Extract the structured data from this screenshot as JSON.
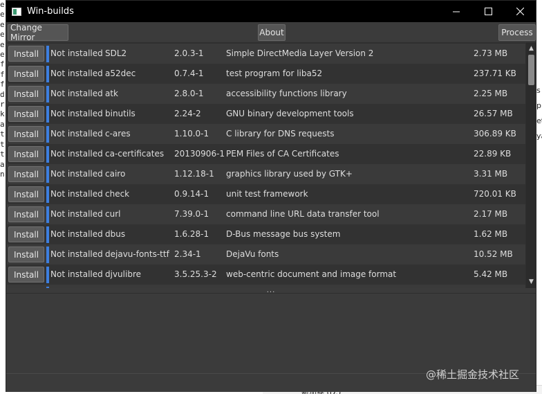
{
  "window": {
    "title": "Win-builds",
    "controls": [
      "minimize-icon",
      "maximize-icon",
      "close-icon"
    ]
  },
  "toolbar": {
    "change_mirror_label": "Change Mirror",
    "about_label": "About",
    "process_label": "Process"
  },
  "packages": [
    {
      "action": "Install",
      "status": "Not installed",
      "name": "SDL2",
      "version": "2.0.3-1",
      "description": "Simple DirectMedia Layer Version 2",
      "size": "2.73 MB"
    },
    {
      "action": "Install",
      "status": "Not installed",
      "name": "a52dec",
      "version": "0.7.4-1",
      "description": "test program for liba52",
      "size": "237.71 KB"
    },
    {
      "action": "Install",
      "status": "Not installed",
      "name": "atk",
      "version": "2.8.0-1",
      "description": "accessibility functions library",
      "size": "2.25 MB"
    },
    {
      "action": "Install",
      "status": "Not installed",
      "name": "binutils",
      "version": "2.24-2",
      "description": "GNU binary development tools",
      "size": "26.57 MB"
    },
    {
      "action": "Install",
      "status": "Not installed",
      "name": "c-ares",
      "version": "1.10.0-1",
      "description": "C library for DNS requests",
      "size": "306.89 KB"
    },
    {
      "action": "Install",
      "status": "Not installed",
      "name": "ca-certificates",
      "version": "20130906-1",
      "description": "PEM Files of CA Certificates",
      "size": "22.89 KB"
    },
    {
      "action": "Install",
      "status": "Not installed",
      "name": "cairo",
      "version": "1.12.18-1",
      "description": "graphics library used by GTK+",
      "size": "3.31 MB"
    },
    {
      "action": "Install",
      "status": "Not installed",
      "name": "check",
      "version": "0.9.14-1",
      "description": "unit test framework",
      "size": "720.01 KB"
    },
    {
      "action": "Install",
      "status": "Not installed",
      "name": "curl",
      "version": "7.39.0-1",
      "description": "command line URL data transfer tool",
      "size": "2.17 MB"
    },
    {
      "action": "Install",
      "status": "Not installed",
      "name": "dbus",
      "version": "1.6.28-1",
      "description": "D-Bus message bus system",
      "size": "1.62 MB"
    },
    {
      "action": "Install",
      "status": "Not installed",
      "name": "dejavu-fonts-ttf",
      "version": "2.34-1",
      "description": "DejaVu fonts",
      "size": "10.52 MB"
    },
    {
      "action": "Install",
      "status": "Not installed",
      "name": "djvulibre",
      "version": "3.5.25.3-2",
      "description": "web-centric document and image format",
      "size": "5.42 MB"
    }
  ],
  "splitter": {
    "grip": "..."
  },
  "background": {
    "left_letters": [
      "e",
      "e",
      "e",
      "e",
      "e",
      "e",
      "f",
      "f",
      "f",
      "d",
      "r",
      "k",
      "a",
      "t",
      "t",
      "t",
      "a",
      "n"
    ],
    "right_letters": [
      "s",
      "pi",
      "et",
      "ya"
    ],
    "bottom_text": "新加卷 (D:)",
    "watermark": "@稀土掘金技术社区"
  },
  "colors": {
    "titlebar": "#000000",
    "window_bg": "#3b3b3b",
    "row_even": "#3a3a3a",
    "row_odd": "#323232",
    "status_indicator": "#3d7fe0"
  }
}
